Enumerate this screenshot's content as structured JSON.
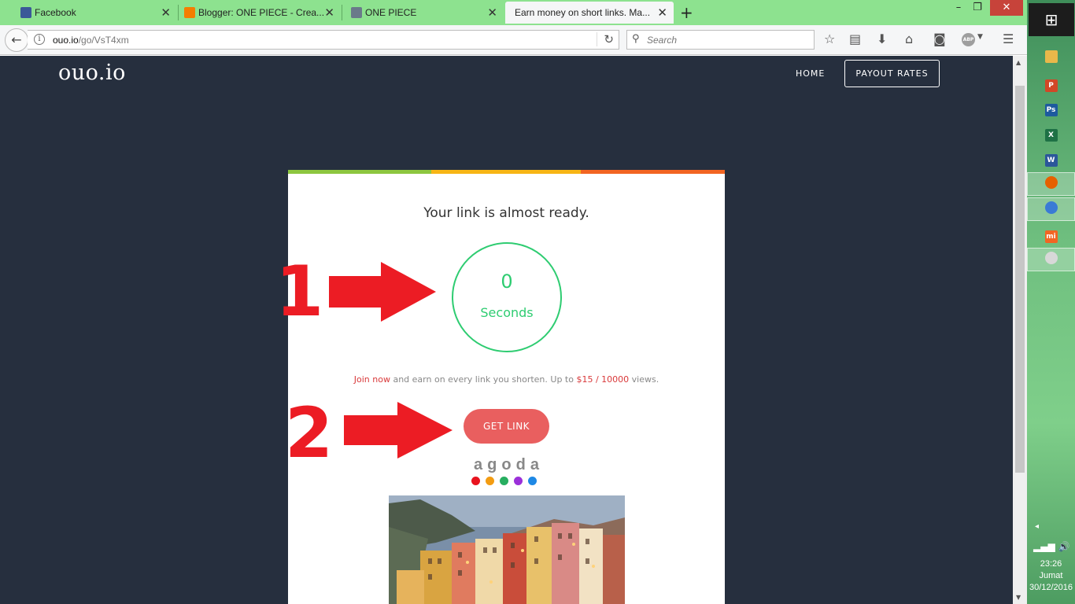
{
  "browser": {
    "tabs": [
      {
        "label": "Facebook",
        "active": false
      },
      {
        "label": "Blogger: ONE PIECE - Crea...",
        "active": false
      },
      {
        "label": "ONE PIECE",
        "active": false
      },
      {
        "label": "Earn money on short links. Ma...",
        "active": true
      }
    ],
    "new_tab_label": "+",
    "url_host": "ouo.io",
    "url_path": "/go/VsT4xm",
    "search_placeholder": "Search",
    "abp_label": "ABP",
    "colors": {
      "tabbar": "#8de28f",
      "toolbar": "#f5f6f7"
    }
  },
  "site": {
    "logo": "ouo.io",
    "nav_home": "HOME",
    "nav_payout": "PAYOUT RATES",
    "background_color": "#262f3e"
  },
  "card": {
    "headline": "Your link is almost ready.",
    "timer_value": "0",
    "timer_unit": "Seconds",
    "promo_join": "Join now",
    "promo_middle": " and earn on every link you shorten. Up to ",
    "promo_rate": "$15 / 10000",
    "promo_end": " views.",
    "get_link_label": "GET LINK",
    "ad_brand": "agoda",
    "stripe_colors": [
      "#8dc63f",
      "#f7b515",
      "#f26522"
    ],
    "accent_green": "#2ecc71",
    "button_color": "#e95f5f"
  },
  "annotations": {
    "step1": "1",
    "step2": "2",
    "color": "#ec1c24"
  },
  "taskbar": {
    "apps": [
      "explorer-icon",
      "powerpoint-icon",
      "photoshop-icon",
      "excel-icon",
      "word-icon",
      "firefox-icon",
      "chrome-icon",
      "xiaomi-icon",
      "paint-icon"
    ],
    "time": "23:26",
    "day": "Jumat",
    "date": "30/12/2016"
  }
}
